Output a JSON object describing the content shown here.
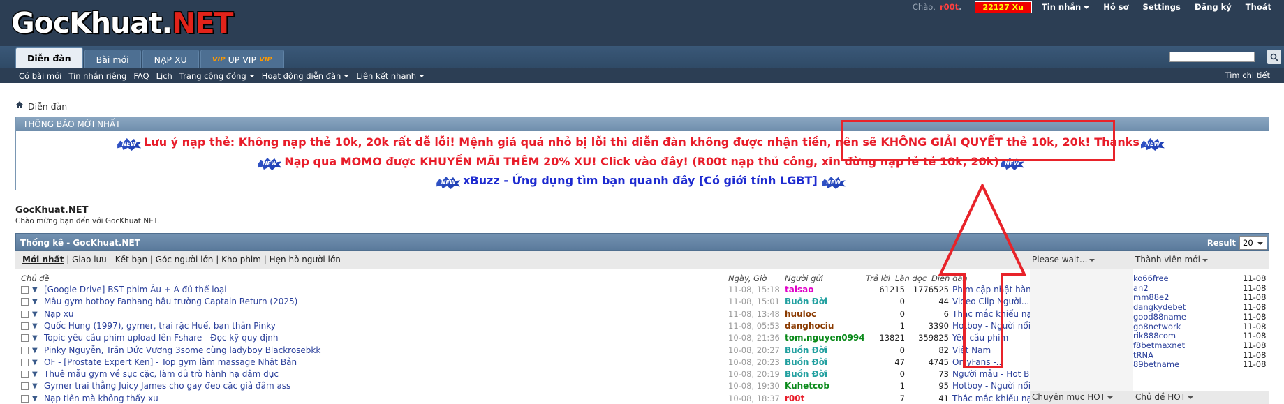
{
  "header": {
    "logo_main": "GocKhuat.",
    "logo_net": "NET",
    "greeting": "Chào,",
    "username": "r00t",
    "username_suffix": ".",
    "xu_balance": "22127 Xu",
    "links": [
      "Tin nhắn",
      "Hồ sơ",
      "Settings",
      "Đăng ký",
      "Thoát"
    ]
  },
  "nav": {
    "tabs": [
      {
        "label": "Diễn đàn",
        "active": true
      },
      {
        "label": "Bài mới",
        "active": false
      },
      {
        "label": "NẠP XU",
        "active": false
      }
    ],
    "vip_tab": {
      "pre": "VIP",
      "mid": " UP VIP ",
      "post": "VIP"
    },
    "search_placeholder": ""
  },
  "subnav": {
    "items": [
      "Có bài mới",
      "Tin nhắn riêng",
      "FAQ",
      "Lịch",
      "Trang cộng đồng",
      "Hoạt động diễn đàn",
      "Liên kết nhanh"
    ],
    "right": "Tìm chi tiết"
  },
  "breadcrumb": "Diễn đàn",
  "notice": {
    "heading": "THÔNG BÁO MỚI NHẤT",
    "badge": "NEW",
    "line1": "Lưu ý nạp thẻ: Không nạp thẻ 10k, 20k rất dễ lỗi! Mệnh giá quá nhỏ bị lỗi thì diễn đàn không được nhận tiền, nên sẽ KHÔNG GIẢI QUYẾT thẻ 10k, 20k! Thanks",
    "line2": "Nạp qua MOMO được KHUYẾN MÃI THÊM 20% XU! Click vào đây! (R00t nạp thủ công, xin đừng nạp lẻ tẻ 10k, 20k)",
    "line3": "xBuzz - Ứng dụng tìm bạn quanh đây [Có giới tính LGBT]"
  },
  "site": {
    "title": "GocKhuat.NET",
    "subtitle": "Chào mừng bạn đến với GocKhuat.NET."
  },
  "stats": {
    "heading": "Thống kê - GocKhuat.NET",
    "result_label": "Result",
    "result_value": "20",
    "filters": [
      "Mới nhất",
      "Giao lưu - Kết bạn",
      "Góc người lớn",
      "Kho phim",
      "Hẹn hò người lớn"
    ],
    "columns": {
      "topic": "Chủ đề",
      "date": "Ngày, Giờ",
      "poster": "Người gửi",
      "replies": "Trả lời",
      "views": "Lần đọc",
      "forum": "Diễn đàn"
    },
    "rows": [
      {
        "title": "[Google Drive] BST phim Âu + Á đủ thể loại",
        "date": "11-08, 15:18",
        "user": "taisao",
        "user_color": "#e000c8",
        "replies": "61215",
        "views": "1776525",
        "forum": "Phim cập nhật hàng..."
      },
      {
        "title": "Mẫu gym hotboy Fanhang hậu trường Captain Return (2025)",
        "date": "11-08, 15:01",
        "user": "Buồn Đời",
        "user_color": "#22a0a0",
        "replies": "0",
        "views": "44",
        "forum": "Video Clip Người..."
      },
      {
        "title": "Nạp xu",
        "date": "11-08, 13:48",
        "user": "huuloc",
        "user_color": "#8a3a00",
        "replies": "0",
        "views": "6",
        "forum": "Thắc mắc khiếu nại..."
      },
      {
        "title": "Quốc Hưng (1997), gymer, trai rặc Huế, bạn thân Pinky",
        "date": "11-08, 05:53",
        "user": "danghociu",
        "user_color": "#8a3a00",
        "replies": "1",
        "views": "3390",
        "forum": "Hotboy - Người nổi..."
      },
      {
        "title": "Topic yêu cầu phim upload lên Fshare - Đọc kỹ quy định",
        "date": "10-08, 21:36",
        "user": "tom.nguyen0994",
        "user_color": "#0a8a1a",
        "replies": "13821",
        "views": "359825",
        "forum": "Yêu cầu phim"
      },
      {
        "title": "Pinky Nguyễn, Trần Đức Vương 3some cùng ladyboy Blackrosebkk",
        "date": "10-08, 20:27",
        "user": "Buồn Đời",
        "user_color": "#22a0a0",
        "replies": "0",
        "views": "82",
        "forum": "Việt Nam"
      },
      {
        "title": "OF - [Prostate Expert Ken] - Top gym làm massage Nhật Bản",
        "date": "10-08, 20:23",
        "user": "Buồn Đời",
        "user_color": "#22a0a0",
        "replies": "47",
        "views": "4745",
        "forum": "OnlyFans -..."
      },
      {
        "title": "Thuê mẫu gym về sục cặc, làm đủ trò hành hạ dâm dục",
        "date": "10-08, 20:19",
        "user": "Buồn Đời",
        "user_color": "#22a0a0",
        "replies": "0",
        "views": "73",
        "forum": "Người mẫu - Hot Boy"
      },
      {
        "title": "Gymer trai thẳng Juicy James cho gay đeo cặc giả đâm ass",
        "date": "10-08, 19:30",
        "user": "Kuhetcob",
        "user_color": "#0a8a1a",
        "replies": "1",
        "views": "95",
        "forum": "Hotboy - Người nổi..."
      },
      {
        "title": "Nạp tiền mà không thấy xu",
        "date": "10-08, 18:37",
        "user": "r00t",
        "user_color": "#e81d2a",
        "replies": "7",
        "views": "41",
        "forum": "Thắc mắc khiếu nại..."
      }
    ],
    "wait_label": "Please wait...",
    "members_label": "Thành viên mới",
    "members": [
      {
        "name": "ko66free",
        "date": "11-08"
      },
      {
        "name": "an2",
        "date": "11-08"
      },
      {
        "name": "mm88e2",
        "date": "11-08"
      },
      {
        "name": "dangkydebet",
        "date": "11-08"
      },
      {
        "name": "good88name",
        "date": "11-08"
      },
      {
        "name": "go8network",
        "date": "11-08"
      },
      {
        "name": "rik888com",
        "date": "11-08"
      },
      {
        "name": "f8betmaxnet",
        "date": "11-08"
      },
      {
        "name": "tRNA",
        "date": "11-08"
      },
      {
        "name": "89betname",
        "date": "11-08"
      }
    ],
    "hot_forum_label": "Chuyên mục HOT",
    "hot_topic_label": "Chủ đề HOT"
  },
  "colors": {
    "header_bg": "#2c3e54",
    "accent_red": "#e81d2a",
    "link_blue": "#2a3f9a",
    "annotation_red": "#e8232a"
  }
}
